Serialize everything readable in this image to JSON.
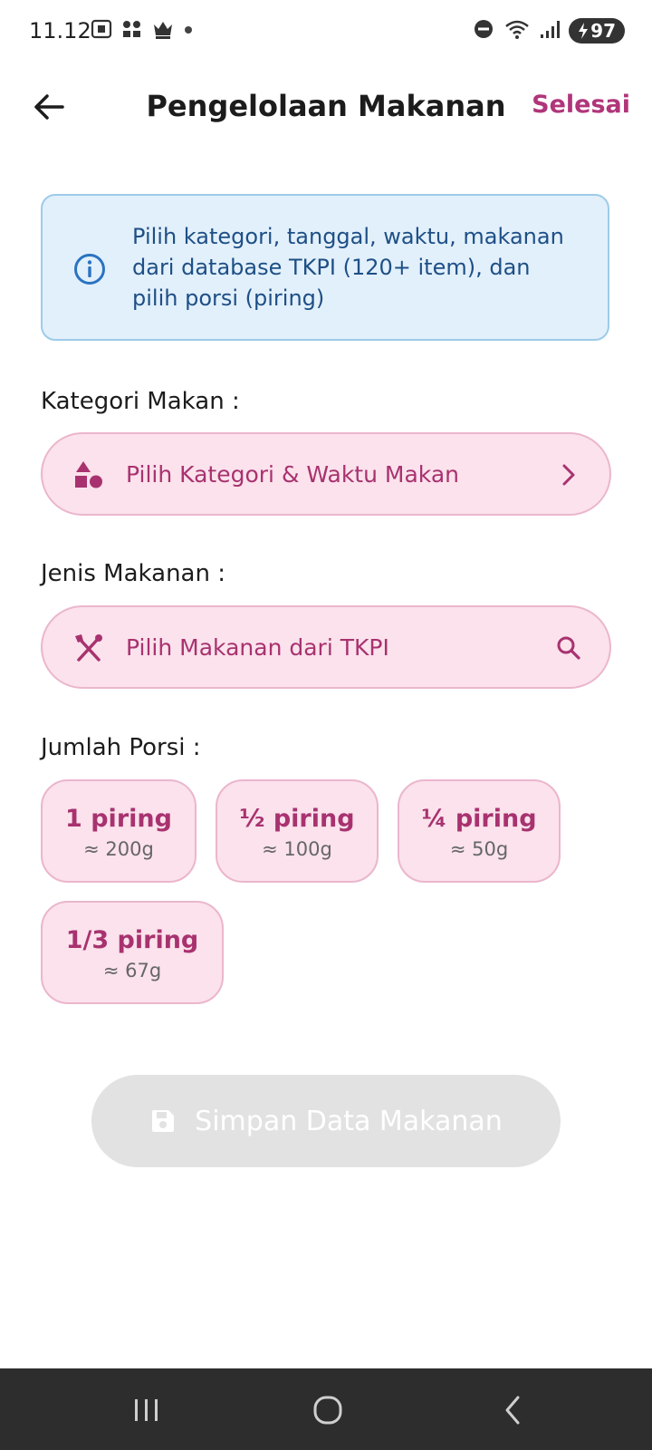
{
  "status_bar": {
    "time": "11.12",
    "battery": "97",
    "icons_left": [
      "screenshot-icon",
      "apps-icon",
      "crown-icon",
      "dot-icon"
    ],
    "icons_right": [
      "do-not-disturb-icon",
      "wifi-icon",
      "signal-icon",
      "battery-icon"
    ]
  },
  "header": {
    "title": "Pengelolaan Makanan",
    "action_label": "Selesai",
    "back_icon": "arrow-left-icon"
  },
  "info": {
    "icon": "info-circle-icon",
    "text_line1": "Pilih kategori, tanggal, waktu, makanan",
    "text_line2": "dari database TKPI (120+ item), dan",
    "text_line3": "pilih porsi (piring)"
  },
  "category": {
    "label": "Kategori Makan :",
    "placeholder": "Pilih Kategori & Waktu Makan",
    "icon": "category-shapes-icon",
    "trailing_icon": "chevron-right-icon"
  },
  "food": {
    "label": "Jenis Makanan :",
    "placeholder": "Pilih Makanan dari TKPI",
    "icon": "utensils-icon",
    "trailing_icon": "search-icon"
  },
  "portion": {
    "label": "Jumlah Porsi :",
    "options": [
      {
        "label": "1 piring",
        "weight": "≈ 200g"
      },
      {
        "label": "½ piring",
        "weight": "≈ 100g"
      },
      {
        "label": "¼ piring",
        "weight": "≈ 50g"
      },
      {
        "label": "1/3 piring",
        "weight": "≈ 67g"
      }
    ]
  },
  "save_button": {
    "label": "Simpan Data Makanan",
    "icon": "save-icon",
    "enabled": false
  },
  "nav": {
    "items": [
      "recent-apps-icon",
      "home-icon",
      "back-icon"
    ]
  },
  "colors": {
    "accent": "#a8326f",
    "accent_light": "#fbe2ec",
    "info_bg": "#e2f0fb",
    "info_text": "#1e4f86",
    "disabled": "#e2e2e2"
  }
}
